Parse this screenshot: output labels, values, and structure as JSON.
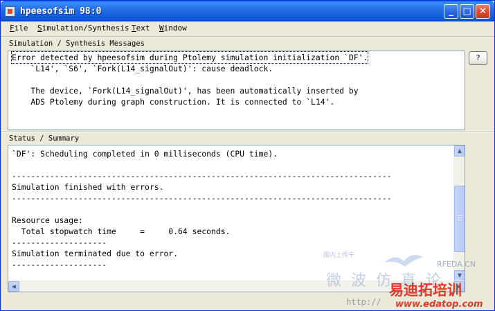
{
  "window": {
    "title": "hpeesofsim 98:0",
    "minimize_glyph": "_",
    "maximize_glyph": "□",
    "close_glyph": "✕"
  },
  "menu": {
    "items": [
      {
        "label": "File"
      },
      {
        "label": "Simulation/Synthesis"
      },
      {
        "label": "Text"
      },
      {
        "label": "Window"
      }
    ]
  },
  "messages_panel": {
    "label": "Simulation / Synthesis Messages",
    "help_button": "?",
    "lines": [
      "Error detected by hpeesofsim during Ptolemy simulation initialization `DF'.",
      "    `L14', `S6', `Fork(L14_signalOut)': cause deadlock.",
      "",
      "    The device, `Fork(L14_signalOut)', has been automatically inserted by",
      "    ADS Ptolemy during graph construction. It is connected to `L14'."
    ]
  },
  "status_panel": {
    "label": "Status / Summary",
    "lines": [
      "`DF': Scheduling completed in 0 milliseconds (CPU time).",
      "",
      "--------------------------------------------------------------------------------",
      "Simulation finished with errors.",
      "--------------------------------------------------------------------------------",
      "",
      "Resource usage:",
      "  Total stopwatch time     =     0.64 seconds.",
      "--------------------",
      "Simulation terminated due to error.",
      "--------------------"
    ],
    "scroll_up_glyph": "▲",
    "scroll_down_glyph": "▼",
    "scroll_left_glyph": "◀",
    "scroll_right_glyph": "▶"
  },
  "watermark": {
    "small_cn": "国内上传干",
    "cn_line": "微波仿真论",
    "rfeda": "RFEDA.CN",
    "url": "http://",
    "big_cn": "易迪拓培训",
    "www": "www.edatop.com"
  },
  "colors": {
    "titlebar": "#0b57d8",
    "window_bg": "#ece9d8",
    "box_border": "#7f9db9",
    "watermark_red": "#e0392a"
  }
}
